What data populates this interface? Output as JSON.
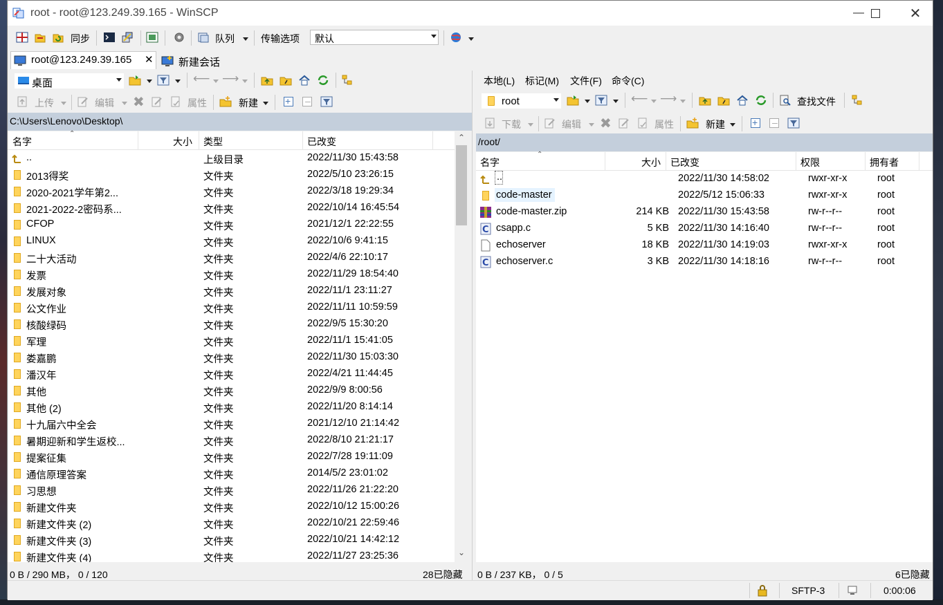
{
  "window": {
    "title": "root - root@123.249.39.165 - WinSCP"
  },
  "toolbar": {
    "sync_label": "同步",
    "queue_label": "队列",
    "transfer_label": "传输选项",
    "transfer_value": "默认"
  },
  "session_tabs": [
    {
      "label": "root@123.249.39.165"
    },
    {
      "label": "新建会话"
    }
  ],
  "left_panel": {
    "drive_label": "桌面",
    "actions": {
      "upload": "上传",
      "edit": "编辑",
      "properties": "属性",
      "new": "新建"
    },
    "path": "C:\\Users\\Lenovo\\Desktop\\",
    "columns": {
      "name": "名字",
      "size": "大小",
      "type": "类型",
      "changed": "已改变"
    },
    "rows": [
      {
        "name": "..",
        "type": "上级目录",
        "changed": "2022/11/30  15:43:58",
        "icon": "parent"
      },
      {
        "name": "2013得奖",
        "type": "文件夹",
        "changed": "2022/5/10  23:26:15"
      },
      {
        "name": "2020-2021学年第2...",
        "type": "文件夹",
        "changed": "2022/3/18  19:29:34"
      },
      {
        "name": "2021-2022-2密码系...",
        "type": "文件夹",
        "changed": "2022/10/14  16:45:54"
      },
      {
        "name": "CFOP",
        "type": "文件夹",
        "changed": "2021/12/1  22:22:55"
      },
      {
        "name": "LINUX",
        "type": "文件夹",
        "changed": "2022/10/6  9:41:15"
      },
      {
        "name": "二十大活动",
        "type": "文件夹",
        "changed": "2022/4/6  22:10:17"
      },
      {
        "name": "发票",
        "type": "文件夹",
        "changed": "2022/11/29  18:54:40"
      },
      {
        "name": "发展对象",
        "type": "文件夹",
        "changed": "2022/11/1  23:11:27"
      },
      {
        "name": "公文作业",
        "type": "文件夹",
        "changed": "2022/11/11  10:59:59"
      },
      {
        "name": "核酸绿码",
        "type": "文件夹",
        "changed": "2022/9/5  15:30:20"
      },
      {
        "name": "军理",
        "type": "文件夹",
        "changed": "2022/11/1  15:41:05"
      },
      {
        "name": "娄嘉鹏",
        "type": "文件夹",
        "changed": "2022/11/30  15:03:30"
      },
      {
        "name": "潘汉年",
        "type": "文件夹",
        "changed": "2022/4/21  11:44:45"
      },
      {
        "name": "其他",
        "type": "文件夹",
        "changed": "2022/9/9  8:00:56"
      },
      {
        "name": "其他 (2)",
        "type": "文件夹",
        "changed": "2022/11/20  8:14:14"
      },
      {
        "name": "十九届六中全会",
        "type": "文件夹",
        "changed": "2021/12/10  21:14:42"
      },
      {
        "name": "暑期迎新和学生返校...",
        "type": "文件夹",
        "changed": "2022/8/10  21:21:17"
      },
      {
        "name": "提案征集",
        "type": "文件夹",
        "changed": "2022/7/28  19:11:09"
      },
      {
        "name": "通信原理答案",
        "type": "文件夹",
        "changed": "2014/5/2  23:01:02"
      },
      {
        "name": "习思想",
        "type": "文件夹",
        "changed": "2022/11/26  21:22:20"
      },
      {
        "name": "新建文件夹",
        "type": "文件夹",
        "changed": "2022/10/12  15:00:26"
      },
      {
        "name": "新建文件夹 (2)",
        "type": "文件夹",
        "changed": "2022/10/21  22:59:46"
      },
      {
        "name": "新建文件夹 (3)",
        "type": "文件夹",
        "changed": "2022/10/21  14:42:12"
      },
      {
        "name": "新建文件夹 (4)",
        "type": "文件夹",
        "changed": "2022/11/27  23:25:36"
      }
    ],
    "status": {
      "summary": "0 B / 290 MB，  0 / 120",
      "hidden": "28已隐藏"
    }
  },
  "right_panel": {
    "menu": [
      "本地(L)",
      "标记(M)",
      "文件(F)",
      "命令(C)"
    ],
    "dir_label": "root",
    "find_label": "查找文件",
    "actions": {
      "download": "下载",
      "edit": "编辑",
      "properties": "属性",
      "new": "新建"
    },
    "path": "/root/",
    "columns": {
      "name": "名字",
      "size": "大小",
      "changed": "已改变",
      "rights": "权限",
      "owner": "拥有者"
    },
    "rows": [
      {
        "name": "..",
        "size": "",
        "changed": "2022/11/30 14:58:02",
        "rights": "rwxr-xr-x",
        "owner": "root",
        "icon": "parent"
      },
      {
        "name": "code-master",
        "size": "",
        "changed": "2022/5/12 15:06:33",
        "rights": "rwxr-xr-x",
        "owner": "root",
        "icon": "folder"
      },
      {
        "name": "code-master.zip",
        "size": "214 KB",
        "changed": "2022/11/30 15:43:58",
        "rights": "rw-r--r--",
        "owner": "root",
        "icon": "zip"
      },
      {
        "name": "csapp.c",
        "size": "5 KB",
        "changed": "2022/11/30 14:16:40",
        "rights": "rw-r--r--",
        "owner": "root",
        "icon": "c"
      },
      {
        "name": "echoserver",
        "size": "18 KB",
        "changed": "2022/11/30 14:19:03",
        "rights": "rwxr-xr-x",
        "owner": "root",
        "icon": "file"
      },
      {
        "name": "echoserver.c",
        "size": "3 KB",
        "changed": "2022/11/30 14:18:16",
        "rights": "rw-r--r--",
        "owner": "root",
        "icon": "c"
      }
    ],
    "status": {
      "summary": "0 B / 237 KB，  0 / 5",
      "hidden": "6已隐藏"
    }
  },
  "statusbar": {
    "protocol": "SFTP-3",
    "elapsed": "0:00:06"
  }
}
